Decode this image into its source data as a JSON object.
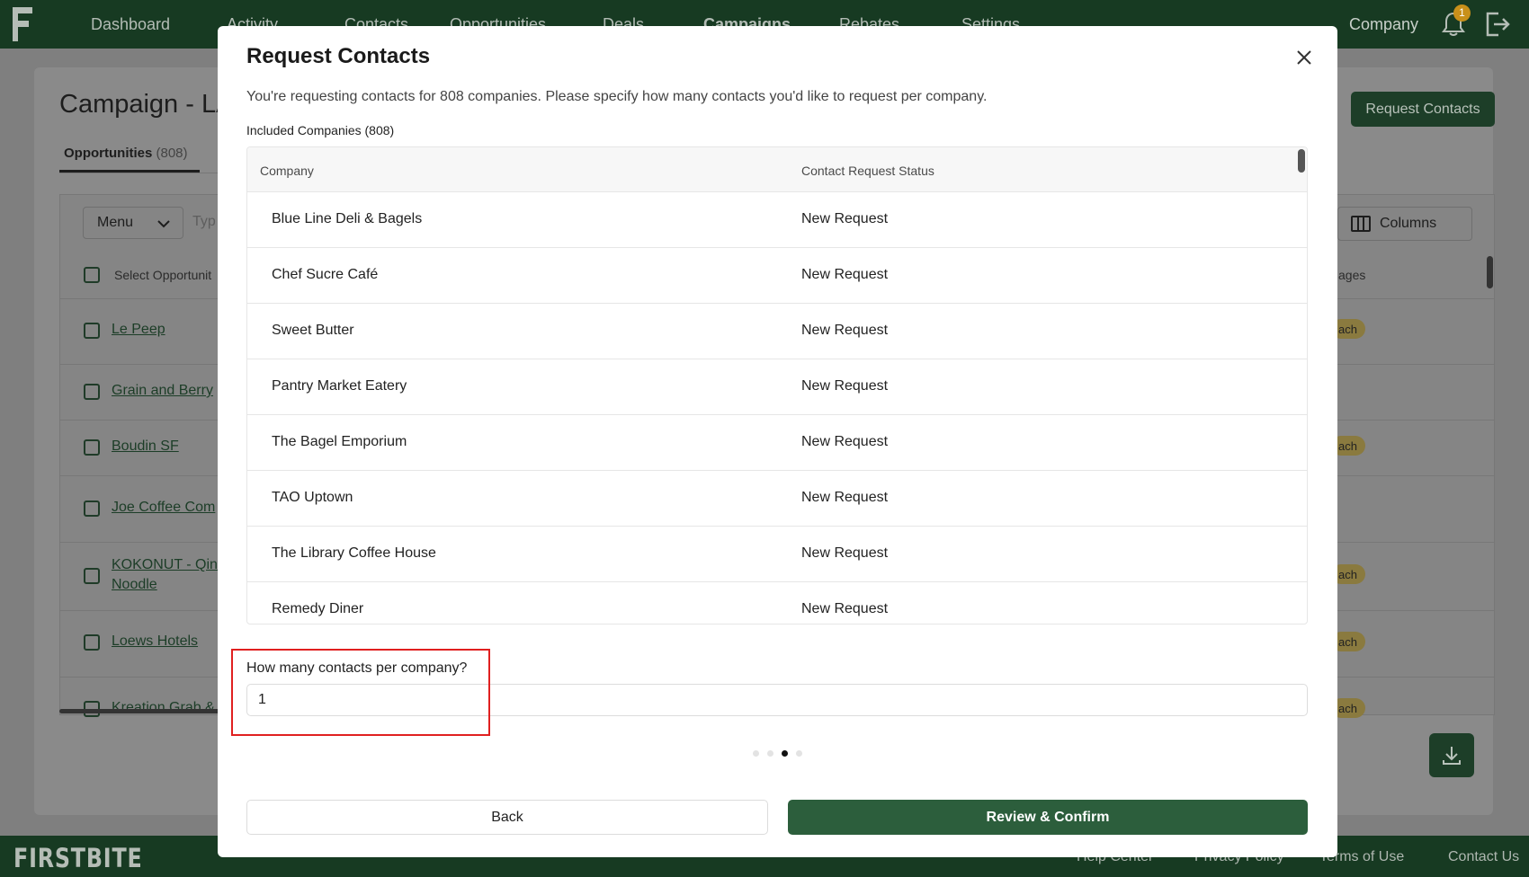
{
  "nav": {
    "items": [
      "Dashboard",
      "Activity",
      "Contacts",
      "Opportunities",
      "Deals",
      "Campaigns",
      "Rebates",
      "Settings"
    ],
    "company_label": "Company",
    "notification_count": "1"
  },
  "campaign": {
    "title": "Campaign - LA",
    "tab_label": "Opportunities",
    "tab_count": "(808)",
    "request_button": "Request Contacts",
    "menu_label": "Menu",
    "search_placeholder": "Typ",
    "columns_label": "Columns",
    "select_header": "Select Opportunit",
    "stages_header": "ages",
    "rows": [
      "Le Peep",
      "Grain and Berry",
      "Boudin SF",
      "Joe Coffee Com",
      "KOKONUT - Qin",
      "Noodle",
      "Loews Hotels",
      "Kreation Grab &"
    ],
    "pill_label": "ach"
  },
  "footer": {
    "logo": "FIRSTBITE",
    "links": [
      "Help Center",
      "Privacy Policy",
      "Terms of Use",
      "Contact Us"
    ]
  },
  "modal": {
    "title": "Request Contacts",
    "description": "You're requesting contacts for 808 companies. Please specify how many contacts you'd like to request per company.",
    "included_label": "Included Companies (808)",
    "columns": [
      "Company",
      "Contact Request Status"
    ],
    "rows": [
      {
        "company": "Blue Line Deli & Bagels",
        "status": "New Request"
      },
      {
        "company": "Chef Sucre Café",
        "status": "New Request"
      },
      {
        "company": "Sweet Butter",
        "status": "New Request"
      },
      {
        "company": "Pantry Market Eatery",
        "status": "New Request"
      },
      {
        "company": "The Bagel Emporium",
        "status": "New Request"
      },
      {
        "company": "TAO Uptown",
        "status": "New Request"
      },
      {
        "company": "The Library Coffee House",
        "status": "New Request"
      },
      {
        "company": "Remedy Diner",
        "status": "New Request"
      }
    ],
    "contacts_question": "How many contacts per company?",
    "contacts_value": "1",
    "back_label": "Back",
    "confirm_label": "Review & Confirm",
    "step_current": 3,
    "step_total": 4
  },
  "colors": {
    "brand_dark": "#173a22",
    "primary_button": "#2c5e3c",
    "highlight": "#e02020"
  }
}
